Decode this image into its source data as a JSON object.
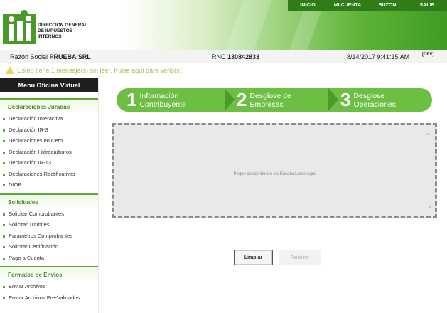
{
  "header": {
    "logo_lines": [
      "DIRECCION GENERAL",
      "DE IMPUESTOS",
      "INTERNOS"
    ],
    "nav": [
      "INICIO",
      "MI CUENTA",
      "BUZON",
      "SALIR"
    ]
  },
  "info": {
    "razon_label": "Razón Social",
    "razon_value": "PRUEBA SRL",
    "rnc_label": "RNC",
    "rnc_value": "130842833",
    "datetime": "8/14/2017 9:41:15 AM",
    "env": "[DEV]"
  },
  "message": "Usted tiene 1 mensaje(s) sin leer. Pulse aquí para verlo(s).",
  "sidebar": {
    "title": "Menu Oficina Virtual",
    "sections": [
      {
        "title": "Declaraciones Juradas",
        "items": [
          "Declaración Interactiva",
          "Declaración IR-3",
          "Declaraciones en Cero",
          "Declaración Hidrocarburos",
          "Declaración IR-13",
          "Declaraciones Rectificativas",
          "DIOR"
        ]
      },
      {
        "title": "Solicitudes",
        "items": [
          "Solicitar Comprobantes",
          "Solicitar Tramites",
          "Parametros Comprobantes",
          "Solicitar Certificación",
          "Pago a Cuenta"
        ]
      },
      {
        "title": "Formatos de Envios",
        "items": [
          "Enviar Archivos",
          "Enviar Archivos Pre-Validados"
        ]
      }
    ]
  },
  "steps": [
    {
      "num": "1",
      "line1": "Información",
      "line2": "Contribuyente"
    },
    {
      "num": "2",
      "line1": "Desglose de",
      "line2": "Empresas"
    },
    {
      "num": "3",
      "line1": "Desglose",
      "line2": "Operaciones"
    }
  ],
  "content": {
    "placeholder": "Pegue contenido sin los Encabezados Aqui"
  },
  "buttons": {
    "limpiar": "Limpiar",
    "finalizar": "Finalizar"
  },
  "colors": {
    "brand_green": "#5aab35",
    "nav_green": "#2e7d18",
    "step_green": "#6cbf43"
  }
}
